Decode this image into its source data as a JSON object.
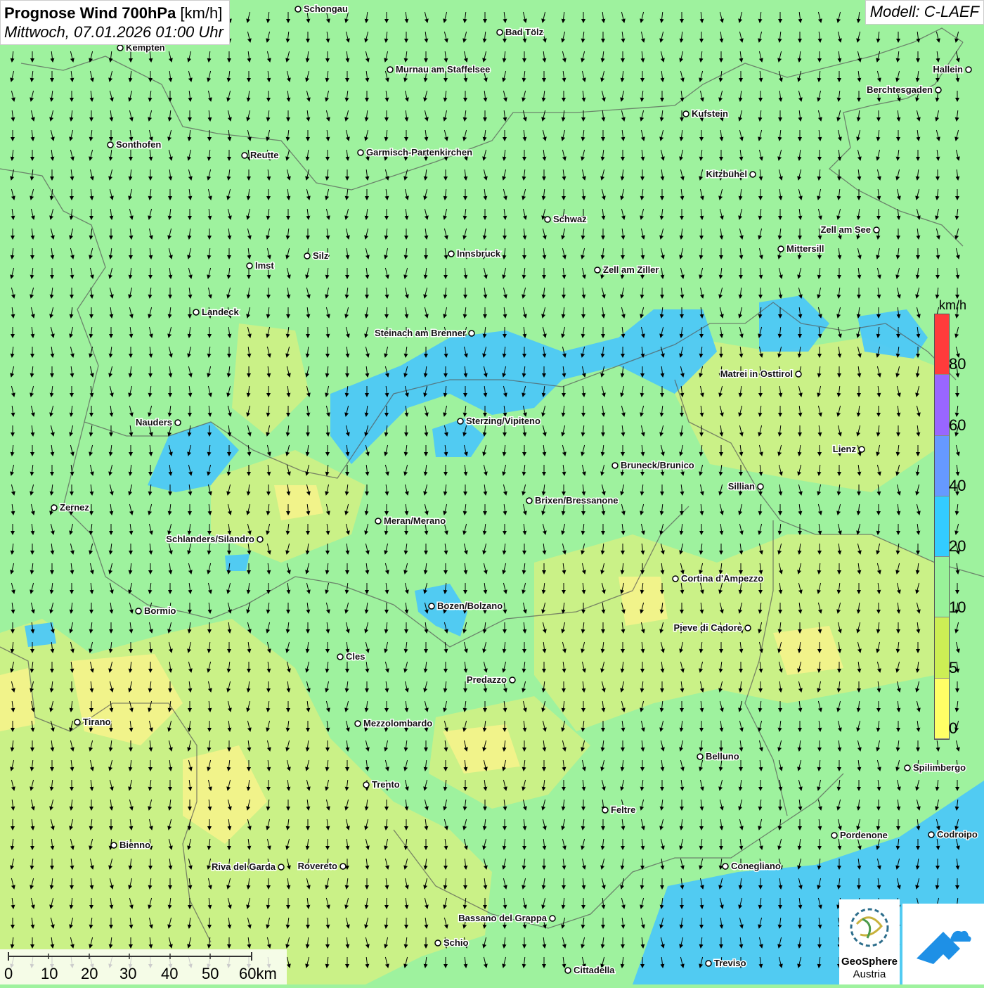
{
  "header": {
    "title_bold": "Prognose Wind 700hPa",
    "title_unit": " [km/h]",
    "subtitle": "Mittwoch, 07.01.2026 01:00 Uhr",
    "model": "Modell: C-LAEF"
  },
  "legend": {
    "unit": "km/h",
    "ticks": [
      "80",
      "60",
      "40",
      "20",
      "10",
      "5",
      "0"
    ],
    "colors": [
      "#ff3b3b",
      "#9966ff",
      "#6699ff",
      "#33ccff",
      "#99f299",
      "#ccee55",
      "#ffff66"
    ]
  },
  "scale": {
    "labels": [
      "0",
      "10",
      "20",
      "30",
      "40",
      "50",
      "60km"
    ]
  },
  "logo": {
    "brand": "GeoSphere",
    "sub": "Austria"
  },
  "colors": {
    "calm_yellow": "#f2f28a",
    "light_green": "#9ef29e",
    "yellowgreen": "#ccf086",
    "blue": "#4dc8f7",
    "sea": "#4dc8f7"
  },
  "map": {
    "wind_direction": "south",
    "cities": [
      {
        "name": "Schongau"
      },
      {
        "name": "Bad Tölz"
      },
      {
        "name": "Kempten"
      },
      {
        "name": "Murnau am Staffelsee"
      },
      {
        "name": "Hallein"
      },
      {
        "name": "Berchtesgaden"
      },
      {
        "name": "Kufstein"
      },
      {
        "name": "Sonthofen"
      },
      {
        "name": "Reutte"
      },
      {
        "name": "Garmisch-Partenkirchen"
      },
      {
        "name": "Kitzbühel"
      },
      {
        "name": "Schwaz"
      },
      {
        "name": "Zell am See"
      },
      {
        "name": "Mittersill"
      },
      {
        "name": "Innsbruck"
      },
      {
        "name": "Silz"
      },
      {
        "name": "Imst"
      },
      {
        "name": "Zell am Ziller"
      },
      {
        "name": "Landeck"
      },
      {
        "name": "Steinach am Brenner"
      },
      {
        "name": "Matrei in Osttirol"
      },
      {
        "name": "Nauders"
      },
      {
        "name": "Sterzing/Vipiteno"
      },
      {
        "name": "Lienz"
      },
      {
        "name": "Bruneck/Brunico"
      },
      {
        "name": "Sillian"
      },
      {
        "name": "Brixen/Bressanone"
      },
      {
        "name": "Zernez"
      },
      {
        "name": "Meran/Merano"
      },
      {
        "name": "Schlanders/Silandro"
      },
      {
        "name": "Cortina d'Ampezzo"
      },
      {
        "name": "Bozen/Bolzano"
      },
      {
        "name": "Bormio"
      },
      {
        "name": "Pieve di Cadore"
      },
      {
        "name": "Cles"
      },
      {
        "name": "Predazzo"
      },
      {
        "name": "Tirano"
      },
      {
        "name": "Mezzolombardo"
      },
      {
        "name": "Belluno"
      },
      {
        "name": "Spilimbergo"
      },
      {
        "name": "Trento"
      },
      {
        "name": "Feltre"
      },
      {
        "name": "Bienno"
      },
      {
        "name": "Pordenone"
      },
      {
        "name": "Codroipo"
      },
      {
        "name": "Riva del Garda"
      },
      {
        "name": "Rovereto"
      },
      {
        "name": "Conegliano"
      },
      {
        "name": "Bassano del Grappa"
      },
      {
        "name": "Schio"
      },
      {
        "name": "Treviso"
      },
      {
        "name": "Cittadella"
      }
    ]
  }
}
